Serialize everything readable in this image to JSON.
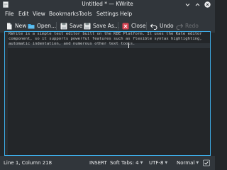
{
  "window": {
    "title": "Untitled * — KWrite"
  },
  "menu": [
    "File",
    "Edit",
    "View",
    "Bookmarks",
    "Tools",
    "Settings",
    "Help"
  ],
  "toolbar": {
    "new": "New",
    "open": "Open...",
    "save": "Save",
    "save_as": "Save As...",
    "close": "Close",
    "undo": "Undo",
    "redo": "Redo"
  },
  "editor": {
    "lines": [
      "KWrite is a simple text editor built on the KDE Platform. It uses the Kate editor",
      "component, so it supports powerful features such as flexible syntax highlighting,",
      "automatic indentation, and numerous other text tools."
    ]
  },
  "status": {
    "position": "Line 1, Column 218",
    "mode": "INSERT",
    "tabs": "Soft Tabs: 4",
    "encoding": "UTF-8",
    "syntax": "Normal"
  },
  "colors": {
    "accent": "#3daee9",
    "close_red": "#da4453"
  }
}
